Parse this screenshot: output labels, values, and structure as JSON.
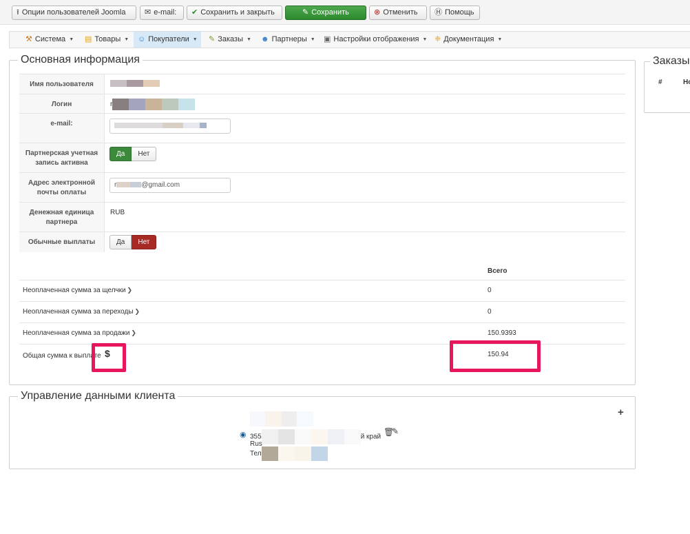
{
  "toolbar": {
    "joomla_options": "Опции пользователей Joomla",
    "email": "e-mail:",
    "save_close": "Сохранить и закрыть",
    "save": "Сохранить",
    "cancel": "Отменить",
    "help": "Помощь"
  },
  "menu": {
    "items": [
      {
        "label": "Система"
      },
      {
        "label": "Товары"
      },
      {
        "label": "Покупатели"
      },
      {
        "label": "Заказы"
      },
      {
        "label": "Партнеры"
      },
      {
        "label": "Настройки отображения"
      },
      {
        "label": "Документация"
      }
    ]
  },
  "basic": {
    "legend": "Основная информация",
    "username_label": "Имя пользователя",
    "login_label": "Логин",
    "login_prefix": "r",
    "email_label": "e-mail:",
    "affiliate_active_label": "Партнерская учетная запись активна",
    "payment_email_label": "Адрес электронной почты оплаты",
    "payment_email_prefix": "r",
    "payment_email_suffix": "@gmail.com",
    "currency_label": "Денежная единица партнера",
    "currency_value": "RUB",
    "regular_payouts_label": "Обычные выплаты",
    "yes": "Да",
    "no": "Нет"
  },
  "totals": {
    "header": "Всего",
    "rows": [
      {
        "name": "Неоплаченная сумма за щелчки",
        "value": "0"
      },
      {
        "name": "Неоплаченная сумма за переходы",
        "value": "0"
      },
      {
        "name": "Неоплаченная сумма за продажи",
        "value": "150.9393"
      },
      {
        "name": "Общая сумма к выплате",
        "value": "150.94"
      }
    ]
  },
  "client": {
    "legend": "Управление данными клиента",
    "address_prefix": "355",
    "address_suffix": "й край",
    "country_prefix": "Rus",
    "phone_prefix": "Тел"
  },
  "orders": {
    "legend": "Заказы",
    "col_num": "#",
    "col_2": "Но"
  },
  "colors": {
    "highlight": "#e8175d",
    "green": "#3b8a3b",
    "red": "#a72a25"
  }
}
